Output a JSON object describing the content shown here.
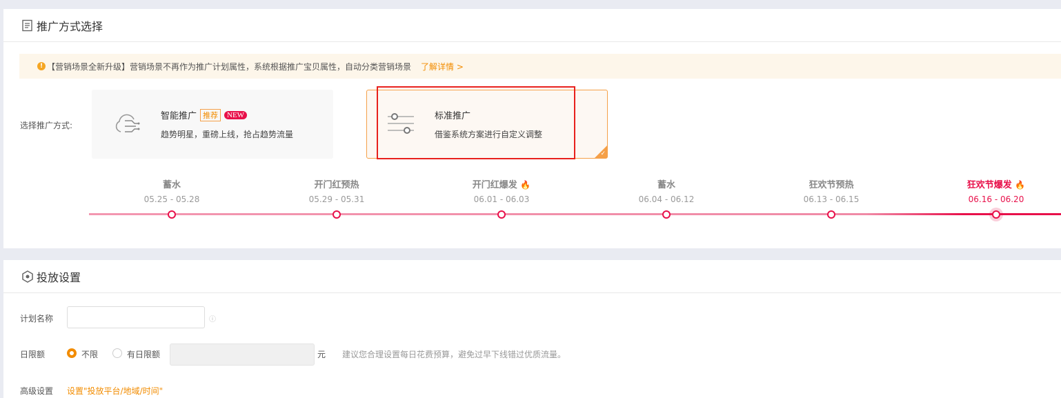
{
  "section1": {
    "title": "推广方式选择",
    "notice": {
      "text": "【营销场景全新升级】营销场景不再作为推广计划属性，系统根据推广宝贝属性，自动分类营销场景",
      "link": "了解详情 >"
    },
    "choose_label": "选择推广方式:",
    "options": [
      {
        "title": "智能推广",
        "tag": "推荐",
        "badge": "NEW",
        "desc": "趋势明星，重磅上线，抢占趋势流量",
        "selected": false
      },
      {
        "title": "标准推广",
        "desc": "借鉴系统方案进行自定义调整",
        "selected": true
      }
    ],
    "timeline": [
      {
        "name": "蓄水",
        "dates": "05.25 - 05.28"
      },
      {
        "name": "开门红预热",
        "dates": "05.29 - 05.31"
      },
      {
        "name": "开门红爆发",
        "dates": "06.01 - 06.03",
        "hot": true
      },
      {
        "name": "蓄水",
        "dates": "06.04 - 06.12"
      },
      {
        "name": "狂欢节预热",
        "dates": "06.13 - 06.15"
      },
      {
        "name": "狂欢节爆发",
        "dates": "06.16 - 06.20",
        "hot": true,
        "active": true
      }
    ]
  },
  "section2": {
    "title": "投放设置",
    "plan_name_label": "计划名称",
    "plan_name_value": "",
    "daily_label": "日限额",
    "radio_unlimited": "不限",
    "radio_limited": "有日限额",
    "unit": "元",
    "hint": "建议您合理设置每日花费预算，避免过早下线错过优质流量。",
    "advanced_label": "高级设置",
    "advanced_link": "设置\"投放平台/地域/时间\""
  },
  "colors": {
    "accent": "#f28c00",
    "hot": "#e8104a"
  }
}
